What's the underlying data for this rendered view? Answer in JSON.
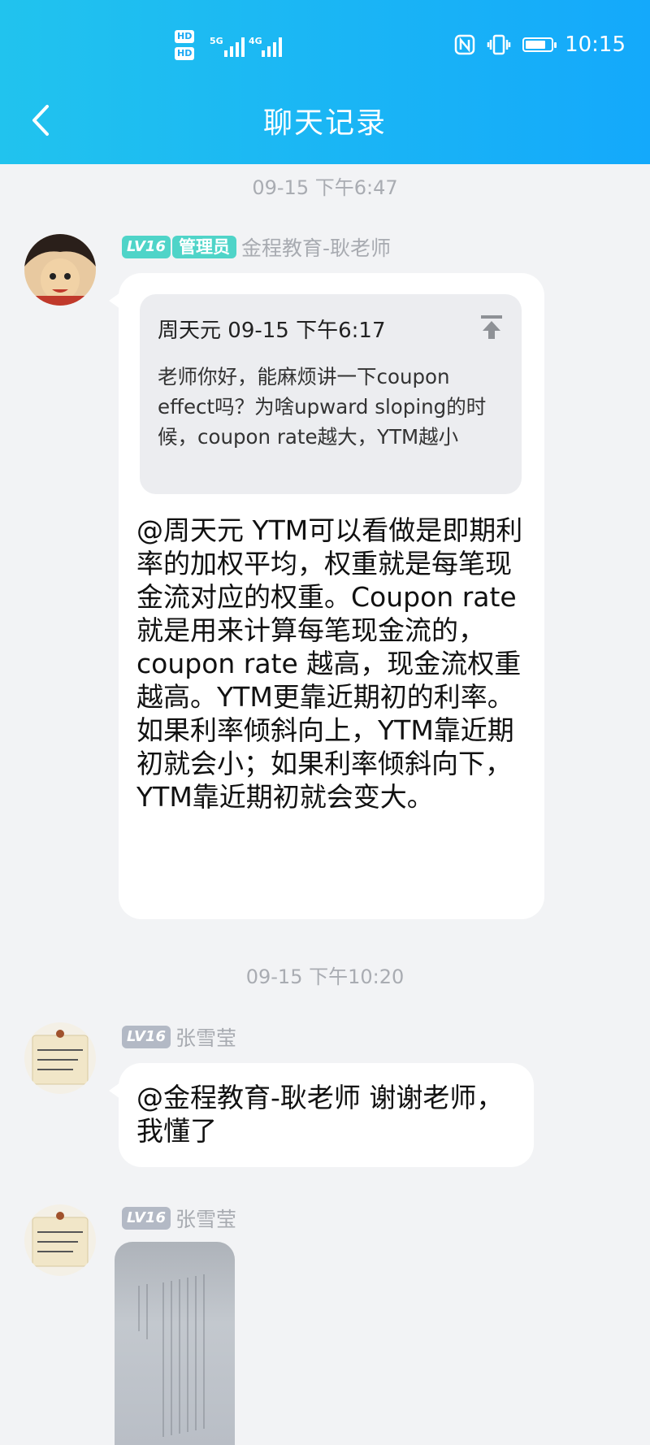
{
  "status_bar": {
    "sim1": "HD",
    "sim2": "HD",
    "net1": "5G",
    "net2": "4G",
    "time": "10:15",
    "icons": [
      "nfc-icon",
      "vibrate-icon",
      "battery-icon",
      "signal-icon"
    ]
  },
  "header": {
    "title": "聊天记录",
    "back_icon": "chevron-left-icon"
  },
  "messages": [
    {
      "timestamp": "09-15 下午6:47",
      "level": "LV16",
      "role": "管理员",
      "sender": "金程教育-耿老师",
      "quote": {
        "author": "周天元",
        "time": "09-15 下午6:17",
        "text": "老师你好，能麻烦讲一下coupon effect吗？为啥upward sloping的时候，coupon rate越大，YTM越小"
      },
      "text": "@周天元 YTM可以看做是即期利率的加权平均，权重就是每笔现金流对应的权重。Coupon rate就是用来计算每笔现金流的，coupon rate 越高，现金流权重越高。YTM更靠近期初的利率。如果利率倾斜向上，YTM靠近期初就会小；如果利率倾斜向下，YTM靠近期初就会变大。"
    },
    {
      "timestamp": "09-15 下午10:20",
      "level": "LV16",
      "sender": "张雪莹",
      "text": "@金程教育-耿老师 谢谢老师，我懂了"
    },
    {
      "level": "LV16",
      "sender": "张雪莹",
      "attachment": "image"
    }
  ],
  "colors": {
    "header_start": "#21c3ee",
    "header_end": "#14a9fb",
    "background": "#f2f3f5",
    "admin_badge": "#4fd4c8",
    "level_badge_grey": "#b3b9c5",
    "meta_text": "#a8abb1"
  }
}
